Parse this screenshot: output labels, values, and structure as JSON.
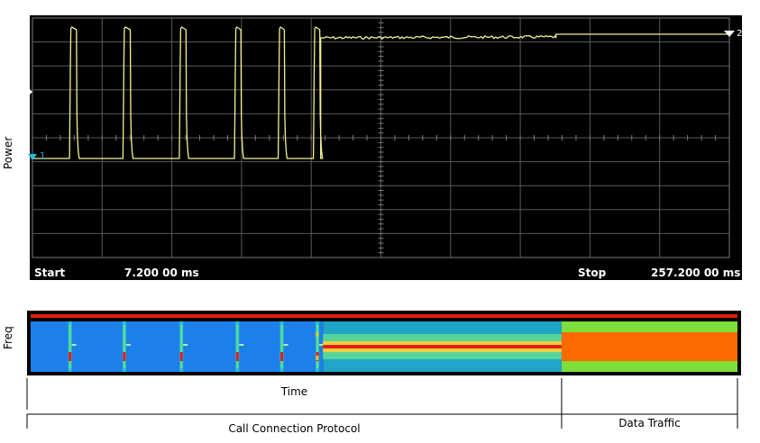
{
  "chart_data": {
    "type": "line",
    "ylabel": "Power",
    "freq_label": "Freq",
    "xlabel": "Time",
    "start_label": "Start",
    "start_value": "7.200 00 ms",
    "stop_label": "Stop",
    "stop_value": "257.200 00 ms",
    "xlim_ms": [
      7.2,
      257.2
    ],
    "marker1": "1",
    "marker2": "2",
    "segments": [
      {
        "label": "Call Connection Protocol",
        "start_ms": 7.2,
        "end_ms": 195.0
      },
      {
        "label": "Data Traffic",
        "start_ms": 195.0,
        "end_ms": 257.2
      }
    ],
    "bursts_ms": [
      {
        "start": 20.8,
        "end": 23.3
      },
      {
        "start": 40.0,
        "end": 42.6
      },
      {
        "start": 60.2,
        "end": 62.6
      },
      {
        "start": 80.0,
        "end": 82.3
      },
      {
        "start": 95.7,
        "end": 97.9
      },
      {
        "start": 108.3,
        "end": 110.6
      }
    ],
    "traffic_start_ms": 110.6,
    "step_ms": 195.0,
    "colors": {
      "trace": "#f6f090",
      "grid": "#5a5a5a",
      "marker": "#1fb8e8",
      "spectrogram_bg": "#1e7fea",
      "spectrogram_red": "#e81c10",
      "spectrogram_orange": "#f96a00",
      "spectrogram_green": "#7ede3a"
    }
  }
}
